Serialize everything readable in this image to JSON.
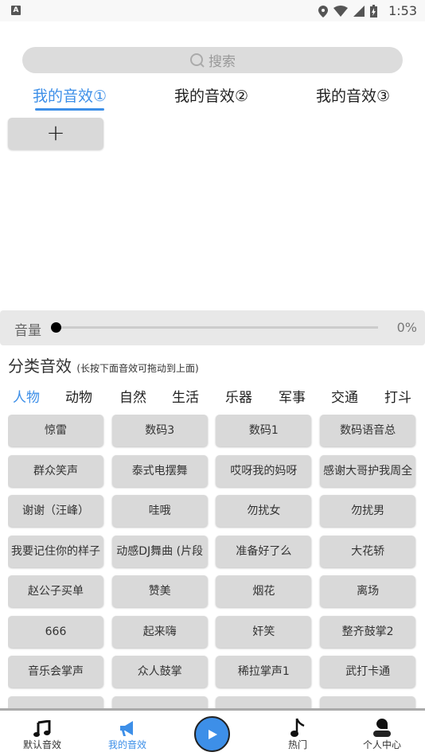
{
  "status_bar": {
    "time": "1:53",
    "app_icon": "A"
  },
  "search": {
    "placeholder": "搜索",
    "icon": "search-icon"
  },
  "my_tabs": [
    {
      "label": "我的音效①",
      "active": true
    },
    {
      "label": "我的音效②",
      "active": false
    },
    {
      "label": "我的音效③",
      "active": false
    }
  ],
  "add_button": {
    "label": "+"
  },
  "volume": {
    "label": "音量",
    "value_text": "0%",
    "value": 0
  },
  "category": {
    "title": "分类音效",
    "hint": "(长按下面音效可拖动到上面)"
  },
  "categories": [
    {
      "label": "人物",
      "active": true
    },
    {
      "label": "动物"
    },
    {
      "label": "自然"
    },
    {
      "label": "生活"
    },
    {
      "label": "乐器"
    },
    {
      "label": "军事"
    },
    {
      "label": "交通"
    },
    {
      "label": "打斗"
    }
  ],
  "sounds": [
    "惊雷",
    "数码3",
    "数码1",
    "数码语音总",
    "群众笑声",
    "泰式电摆舞",
    "哎呀我的妈呀",
    "感谢大哥护我周全",
    "谢谢（汪峰）",
    "哇哦",
    "勿扰女",
    "勿扰男",
    "我要记住你的样子",
    "动感DJ舞曲 (片段",
    "准备好了么",
    "大花轿",
    "赵公子买单",
    "赞美",
    "烟花",
    "离场",
    "666",
    "起来嗨",
    "奸笑",
    "整齐鼓掌2",
    "音乐会掌声",
    "众人鼓掌",
    "稀拉掌声1",
    "武打卡通",
    "",
    "",
    "",
    ""
  ],
  "bottom_nav": [
    {
      "label": "默认音效",
      "icon": "music-notes-icon"
    },
    {
      "label": "我的音效",
      "icon": "megaphone-icon",
      "active": true
    },
    {
      "label": "",
      "icon": "play-icon"
    },
    {
      "label": "热门",
      "icon": "music-note-icon"
    },
    {
      "label": "个人中心",
      "icon": "person-icon"
    }
  ],
  "colors": {
    "accent": "#3d8fe8",
    "button": "#d9d9d9"
  }
}
